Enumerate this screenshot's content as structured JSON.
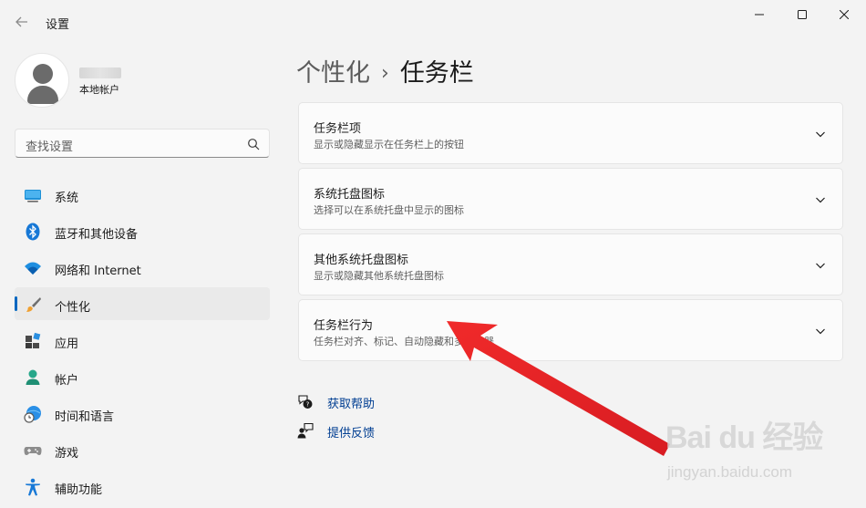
{
  "window": {
    "title": "设置",
    "controls": {
      "minimize": "minimize-icon",
      "maximize": "maximize-icon",
      "close": "close-icon"
    }
  },
  "profile": {
    "account_type": "本地帐户"
  },
  "search": {
    "placeholder": "查找设置"
  },
  "sidebar": {
    "items": [
      {
        "label": "系统",
        "icon": "monitor-icon",
        "active": false
      },
      {
        "label": "蓝牙和其他设备",
        "icon": "bluetooth-icon",
        "active": false
      },
      {
        "label": "网络和 Internet",
        "icon": "wifi-icon",
        "active": false
      },
      {
        "label": "个性化",
        "icon": "brush-icon",
        "active": true
      },
      {
        "label": "应用",
        "icon": "apps-icon",
        "active": false
      },
      {
        "label": "帐户",
        "icon": "person-icon",
        "active": false
      },
      {
        "label": "时间和语言",
        "icon": "globe-clock-icon",
        "active": false
      },
      {
        "label": "游戏",
        "icon": "gamepad-icon",
        "active": false
      },
      {
        "label": "辅助功能",
        "icon": "accessibility-icon",
        "active": false
      }
    ]
  },
  "breadcrumb": {
    "parent": "个性化",
    "separator": "›",
    "current": "任务栏"
  },
  "cards": [
    {
      "title": "任务栏项",
      "description": "显示或隐藏显示在任务栏上的按钮"
    },
    {
      "title": "系统托盘图标",
      "description": "选择可以在系统托盘中显示的图标"
    },
    {
      "title": "其他系统托盘图标",
      "description": "显示或隐藏其他系统托盘图标"
    },
    {
      "title": "任务栏行为",
      "description": "任务栏对齐、标记、自动隐藏和多显示器"
    }
  ],
  "links": {
    "help": "获取帮助",
    "feedback": "提供反馈"
  },
  "watermark": {
    "brand": "Bai du 经验",
    "url": "jingyan.baidu.com"
  },
  "colors": {
    "accent": "#0067c0",
    "annotation_arrow": "#e8202a",
    "background": "#f3f3f3",
    "card": "#fbfbfb"
  }
}
